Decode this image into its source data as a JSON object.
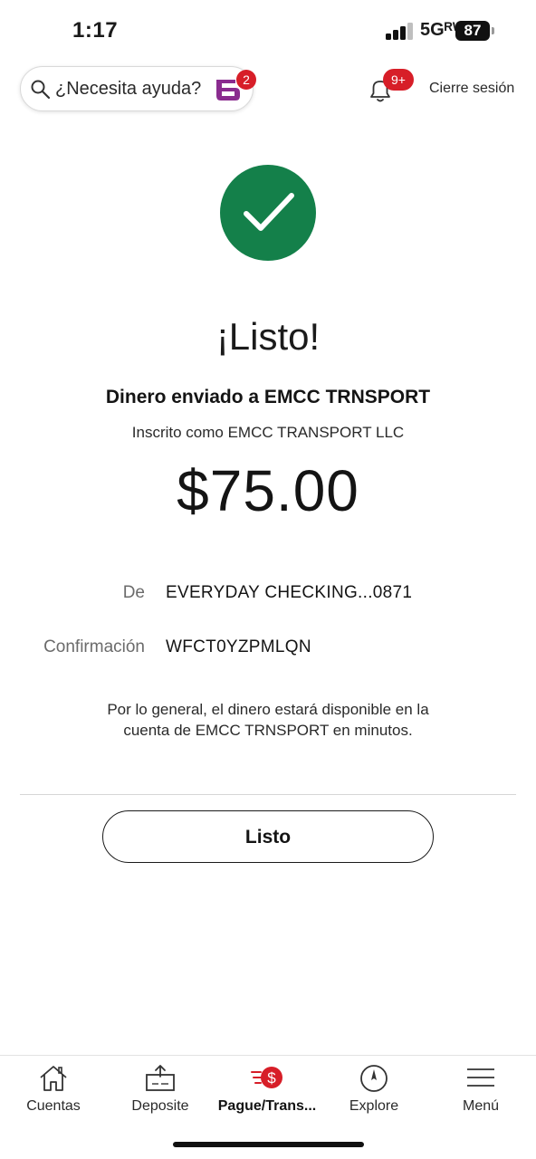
{
  "status_bar": {
    "time": "1:17",
    "network": "5Gᴿᵂ",
    "battery": "87"
  },
  "header": {
    "search_placeholder": "¿Necesita ayuda?",
    "assistant_badge": "2",
    "notifications_badge": "9+",
    "logout_label": "Cierre sesión"
  },
  "confirmation": {
    "title": "¡Listo!",
    "sent_to": "Dinero enviado a EMCC TRNSPORT",
    "enrolled_as": "Inscrito como EMCC TRANSPORT LLC",
    "amount": "$75.00",
    "details": [
      {
        "label": "De",
        "value": "EVERYDAY CHECKING...0871"
      },
      {
        "label": "Confirmación",
        "value": "WFCT0YZPMLQN"
      }
    ],
    "note": "Por lo general, el dinero estará disponible en la cuenta de EMCC TRNSPORT en minutos.",
    "done_button": "Listo"
  },
  "colors": {
    "success_green": "#14804a",
    "brand_red": "#d71e28",
    "assistant_purple": "#8a2c8f"
  },
  "bottom_nav": [
    {
      "label": "Cuentas",
      "icon": "home-icon"
    },
    {
      "label": "Deposite",
      "icon": "deposit-icon"
    },
    {
      "label": "Pague/Trans...",
      "icon": "pay-transfer-icon",
      "active": true
    },
    {
      "label": "Explore",
      "icon": "compass-icon"
    },
    {
      "label": "Menú",
      "icon": "menu-icon"
    }
  ]
}
